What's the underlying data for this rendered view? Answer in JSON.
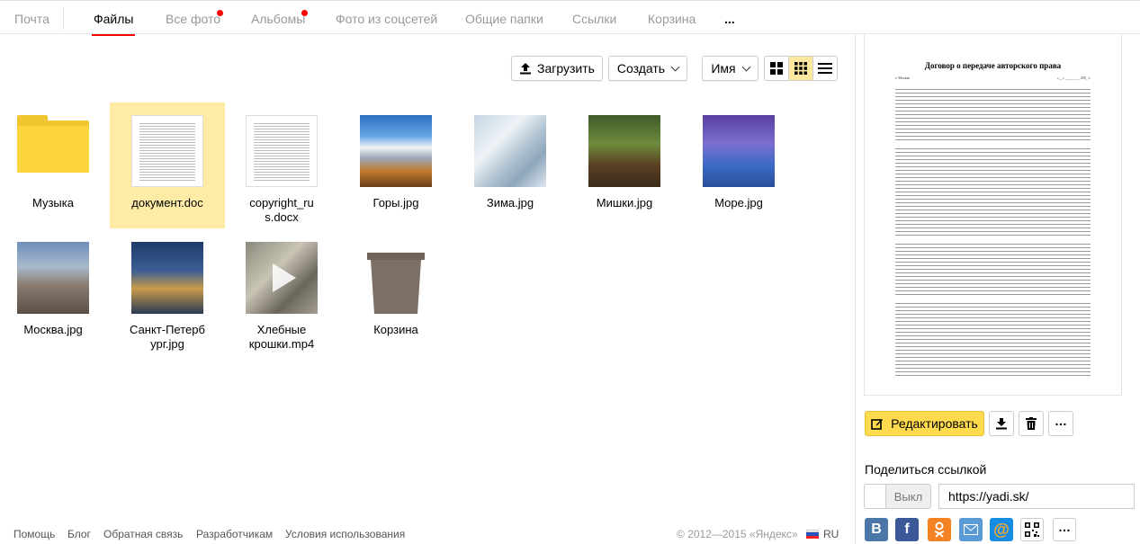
{
  "nav": {
    "items": [
      {
        "label": "Почта",
        "active": false,
        "dot": false
      },
      {
        "label": "Файлы",
        "active": true,
        "dot": false
      },
      {
        "label": "Все фото",
        "active": false,
        "dot": true
      },
      {
        "label": "Альбомы",
        "active": false,
        "dot": true
      },
      {
        "label": "Фото из соцсетей",
        "active": false,
        "dot": false
      },
      {
        "label": "Общие папки",
        "active": false,
        "dot": false
      },
      {
        "label": "Ссылки",
        "active": false,
        "dot": false
      },
      {
        "label": "Корзина",
        "active": false,
        "dot": false
      },
      {
        "label": "...",
        "active": false,
        "dot": false
      }
    ]
  },
  "toolbar": {
    "upload_label": "Загрузить",
    "create_label": "Создать",
    "sort_label": "Имя",
    "view_modes": [
      "large-tiles",
      "small-tiles",
      "list"
    ],
    "active_view": "small-tiles"
  },
  "files": [
    {
      "name": "Музыка",
      "type": "folder"
    },
    {
      "name": "документ.doc",
      "type": "doc",
      "selected": true
    },
    {
      "name": "copyright_ru s.docx",
      "type": "doc"
    },
    {
      "name": "Горы.jpg",
      "type": "image"
    },
    {
      "name": "Зима.jpg",
      "type": "image"
    },
    {
      "name": "Мишки.jpg",
      "type": "image"
    },
    {
      "name": "Море.jpg",
      "type": "image"
    },
    {
      "name": "Москва.jpg",
      "type": "image"
    },
    {
      "name": "Санкт-Петерб ург.jpg",
      "type": "image"
    },
    {
      "name": "Хлебные крошки.mp4",
      "type": "video"
    },
    {
      "name": "Корзина",
      "type": "trash"
    }
  ],
  "footer": {
    "links": [
      "Помощь",
      "Блог",
      "Обратная связь",
      "Разработчикам",
      "Условия использования"
    ],
    "copyright": "© 2012—2015 «Яндекс»",
    "lang": "RU"
  },
  "preview": {
    "doc_title": "Договор о передаче авторского права",
    "city_line": "г. Москва",
    "date_line": "«__» ________ 200_ г."
  },
  "actions": {
    "edit_label": "Редактировать"
  },
  "share": {
    "title": "Поделиться ссылкой",
    "toggle_label": "Выкл",
    "link_value": "https://yadi.sk/",
    "networks": [
      "vk-icon",
      "facebook-icon",
      "odnoklassniki-icon",
      "mail-icon",
      "mailru-icon",
      "qr-icon"
    ]
  },
  "colors": {
    "accent_yellow": "#ffdb4d",
    "selected_bg": "#fdeba6",
    "nav_active_underline": "#ff0000"
  }
}
